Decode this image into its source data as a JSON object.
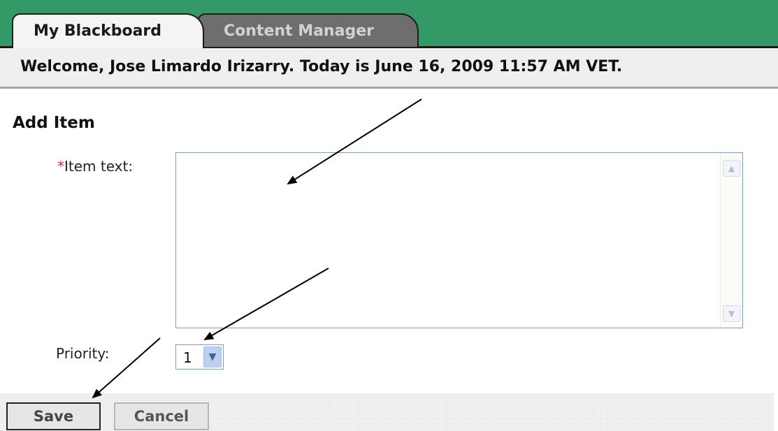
{
  "tabs": [
    {
      "label": "My Blackboard",
      "active": true
    },
    {
      "label": "Content Manager",
      "active": false
    }
  ],
  "welcome": "Welcome, Jose Limardo Irizarry. Today is June 16, 2009 11:57 AM VET.",
  "form": {
    "title": "Add Item",
    "item_text": {
      "required_marker": "*",
      "label": "Item text:",
      "value": ""
    },
    "priority": {
      "label": "Priority:",
      "value": "1"
    }
  },
  "actions": {
    "save_label": "Save",
    "cancel_label": "Cancel"
  },
  "colors": {
    "tab_bar": "#339966",
    "required": "#e32636",
    "arrow": "#000000"
  },
  "annotations": {
    "arrow_count": 3
  }
}
